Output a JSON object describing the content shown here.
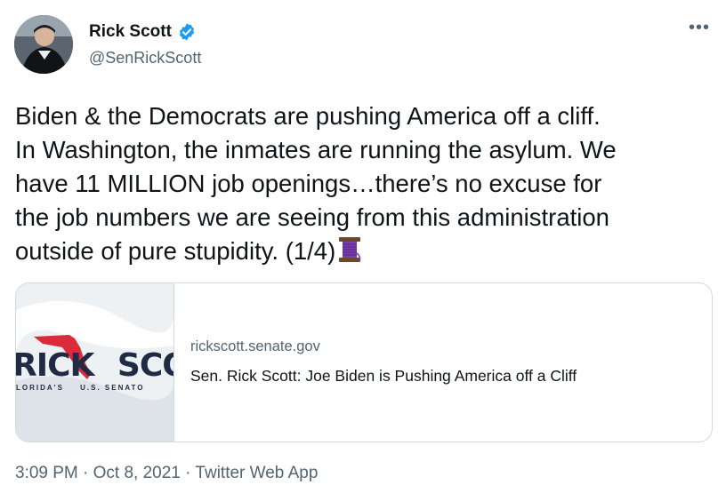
{
  "author": {
    "display_name": "Rick Scott",
    "handle": "@SenRickScott",
    "verified": true,
    "verified_icon": "verified-badge-icon",
    "verified_color": "#1d9bf0"
  },
  "more_icon": "•••",
  "tweet": {
    "text": "Biden & the Democrats are pushing America off a cliff.\nIn Washington, the inmates are running the asylum. We\nhave 11 MILLION job openings…there’s no excuse for\nthe job numbers we are seeing from this administration\noutside of pure stupidity. (1/4)",
    "thread_emoji": "spool-of-thread-icon"
  },
  "card": {
    "domain": "rickscott.senate.gov",
    "title": "Sen. Rick Scott: Joe Biden is Pushing America off a Cliff",
    "logo_left": "RICK",
    "logo_right": "SCOTT",
    "logo_sub_left": "LORIDA'S",
    "logo_sub_right": "U.S. SENATO",
    "logo_color": "#1f2a44",
    "state_color": "#d92b3a"
  },
  "meta": {
    "text": "3:09 PM · Oct 8, 2021 · Twitter Web App"
  }
}
